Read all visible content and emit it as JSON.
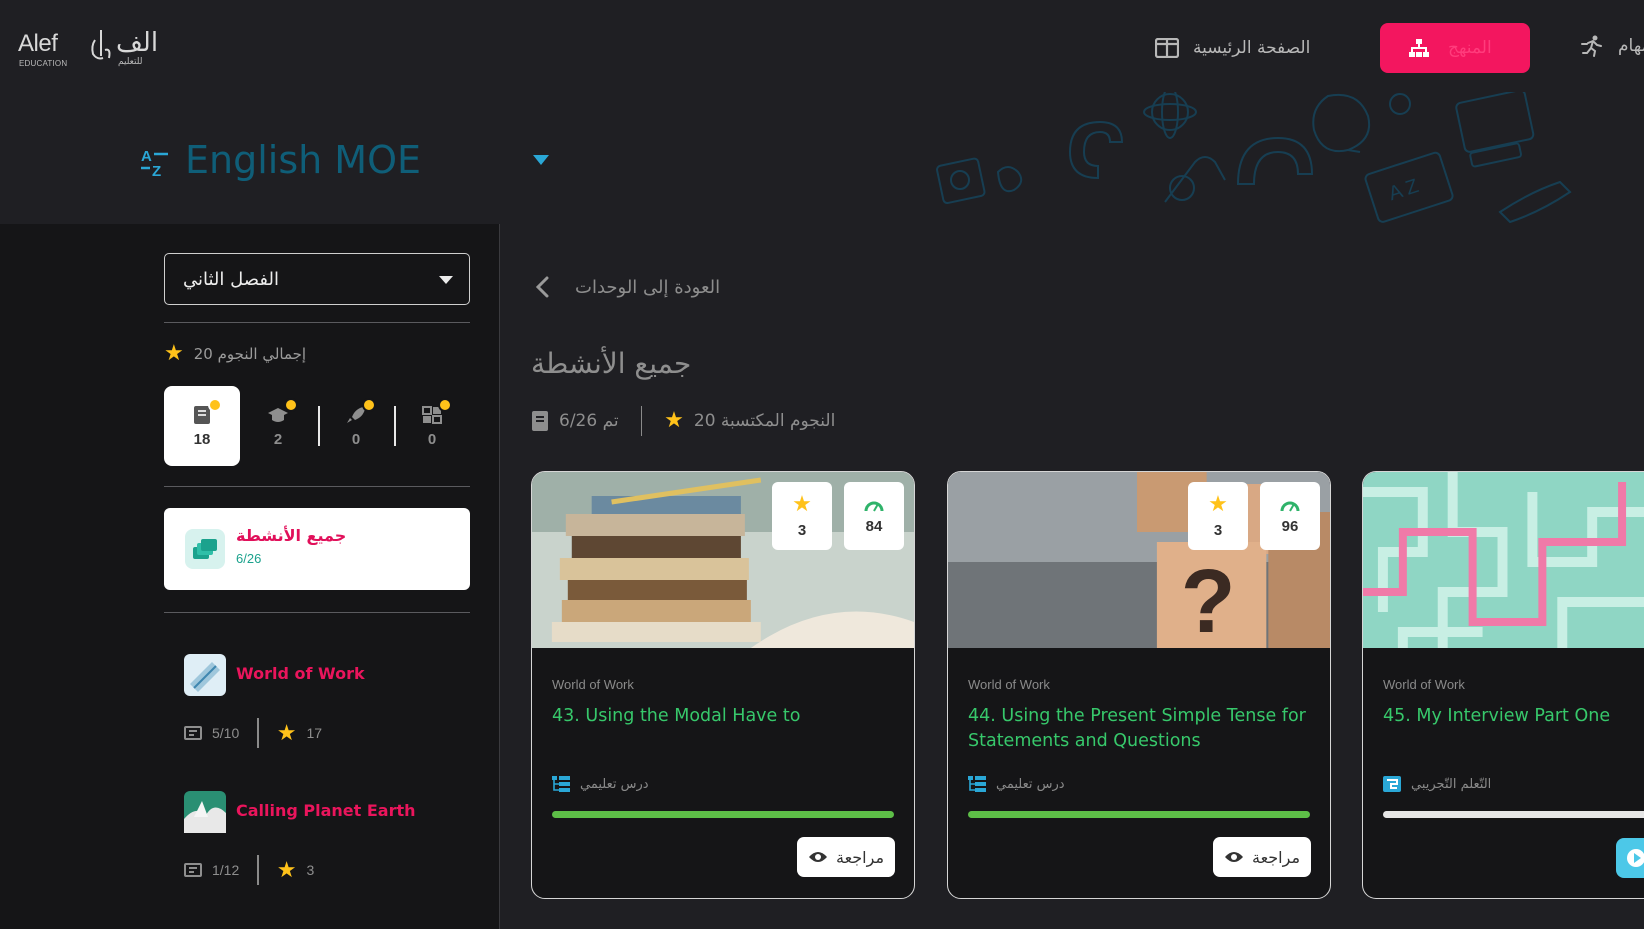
{
  "topbar": {
    "logo_en": "Alef",
    "logo_ar": "الف",
    "logo_sub_en": "EDUCATION",
    "logo_sub_ar": "للتعليم",
    "nav_home": "الصفحة الرئيسية",
    "nav_curriculum": "المنهج",
    "nav_tasks": "مهام"
  },
  "subject": {
    "title": "English MOE"
  },
  "sidebar": {
    "term": "الفصل الثاني",
    "stars_total_label": "إجمالي النجوم 20",
    "stats": [
      {
        "icon": "book-icon",
        "value": "18"
      },
      {
        "icon": "graduation-cap-icon",
        "value": "2"
      },
      {
        "icon": "rocket-icon",
        "value": "0"
      },
      {
        "icon": "puzzle-icon",
        "value": "0"
      }
    ],
    "all_activities": {
      "title": "جميع الأنشطة",
      "progress": "6/26"
    },
    "units": [
      {
        "name": "World of Work",
        "progress": "5/10",
        "stars": "17"
      },
      {
        "name": "Calling Planet Earth",
        "progress": "1/12",
        "stars": "3"
      }
    ]
  },
  "main": {
    "back_label": "العودة إلى الوحدات",
    "title": "جميع الأنشطة",
    "stars_earned": "النجوم المكتسبة 20",
    "completed": "تم 6/26",
    "cards": [
      {
        "unit": "World of Work",
        "title": "43. Using the Modal Have to",
        "type": "درس تعليمي",
        "stars": "3",
        "score": "84",
        "progress": 1.0,
        "review_label": "مراجعة"
      },
      {
        "unit": "World of Work",
        "title": "44. Using the Present Simple Tense for Statements and Questions",
        "type": "درس تعليمي",
        "stars": "3",
        "score": "96",
        "progress": 1.0,
        "review_label": "مراجعة"
      },
      {
        "unit": "World of Work",
        "title": "45. My Interview Part One",
        "type": "التّعلم التّجريبي",
        "progress": 0.0
      }
    ]
  },
  "colors": {
    "accent": "#f3165f",
    "green": "#37c86b",
    "star": "#ffc21a",
    "subject": "#0f5e78"
  }
}
